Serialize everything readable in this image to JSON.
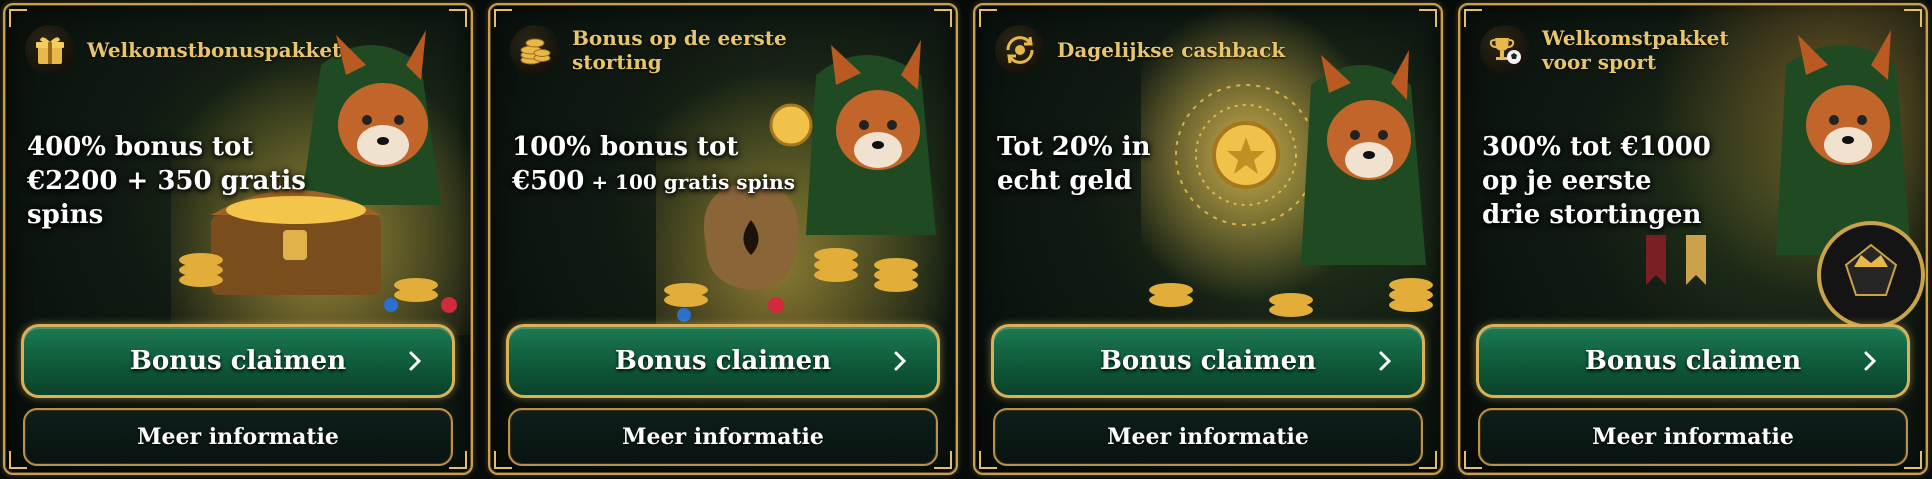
{
  "colors": {
    "gold": "#e8c56a",
    "border_gold": "#c9a04a",
    "button_green": "#1c7a52",
    "text_white": "#ffffff",
    "background": "#070b0a"
  },
  "cards": [
    {
      "icon": "gift-icon",
      "title": "Welkomstbonuspakket",
      "offer_line1": "400% bonus tot",
      "offer_line2_main": "€2200 + 350 gratis spins",
      "offer_line2_small": "",
      "offer_line3": "",
      "claim_label": "Bonus claimen",
      "info_label": "Meer informatie"
    },
    {
      "icon": "coin-stack-icon",
      "title": "Bonus op de eerste storting",
      "offer_line1": "100% bonus tot",
      "offer_line2_main": "€500",
      "offer_line2_small": " + 100 gratis spins",
      "offer_line3": "",
      "claim_label": "Bonus claimen",
      "info_label": "Meer informatie"
    },
    {
      "icon": "cashback-icon",
      "title": "Dagelijkse cashback",
      "offer_line1": "Tot 20% in",
      "offer_line2_main": "echt geld",
      "offer_line2_small": "",
      "offer_line3": "",
      "claim_label": "Bonus claimen",
      "info_label": "Meer informatie"
    },
    {
      "icon": "trophy-ball-icon",
      "title": "Welkomstpakket voor sport",
      "offer_line1": "300% tot €1000",
      "offer_line2_main": "op je eerste",
      "offer_line2_small": "",
      "offer_line3": "drie stortingen",
      "claim_label": "Bonus claimen",
      "info_label": "Meer informatie"
    }
  ]
}
